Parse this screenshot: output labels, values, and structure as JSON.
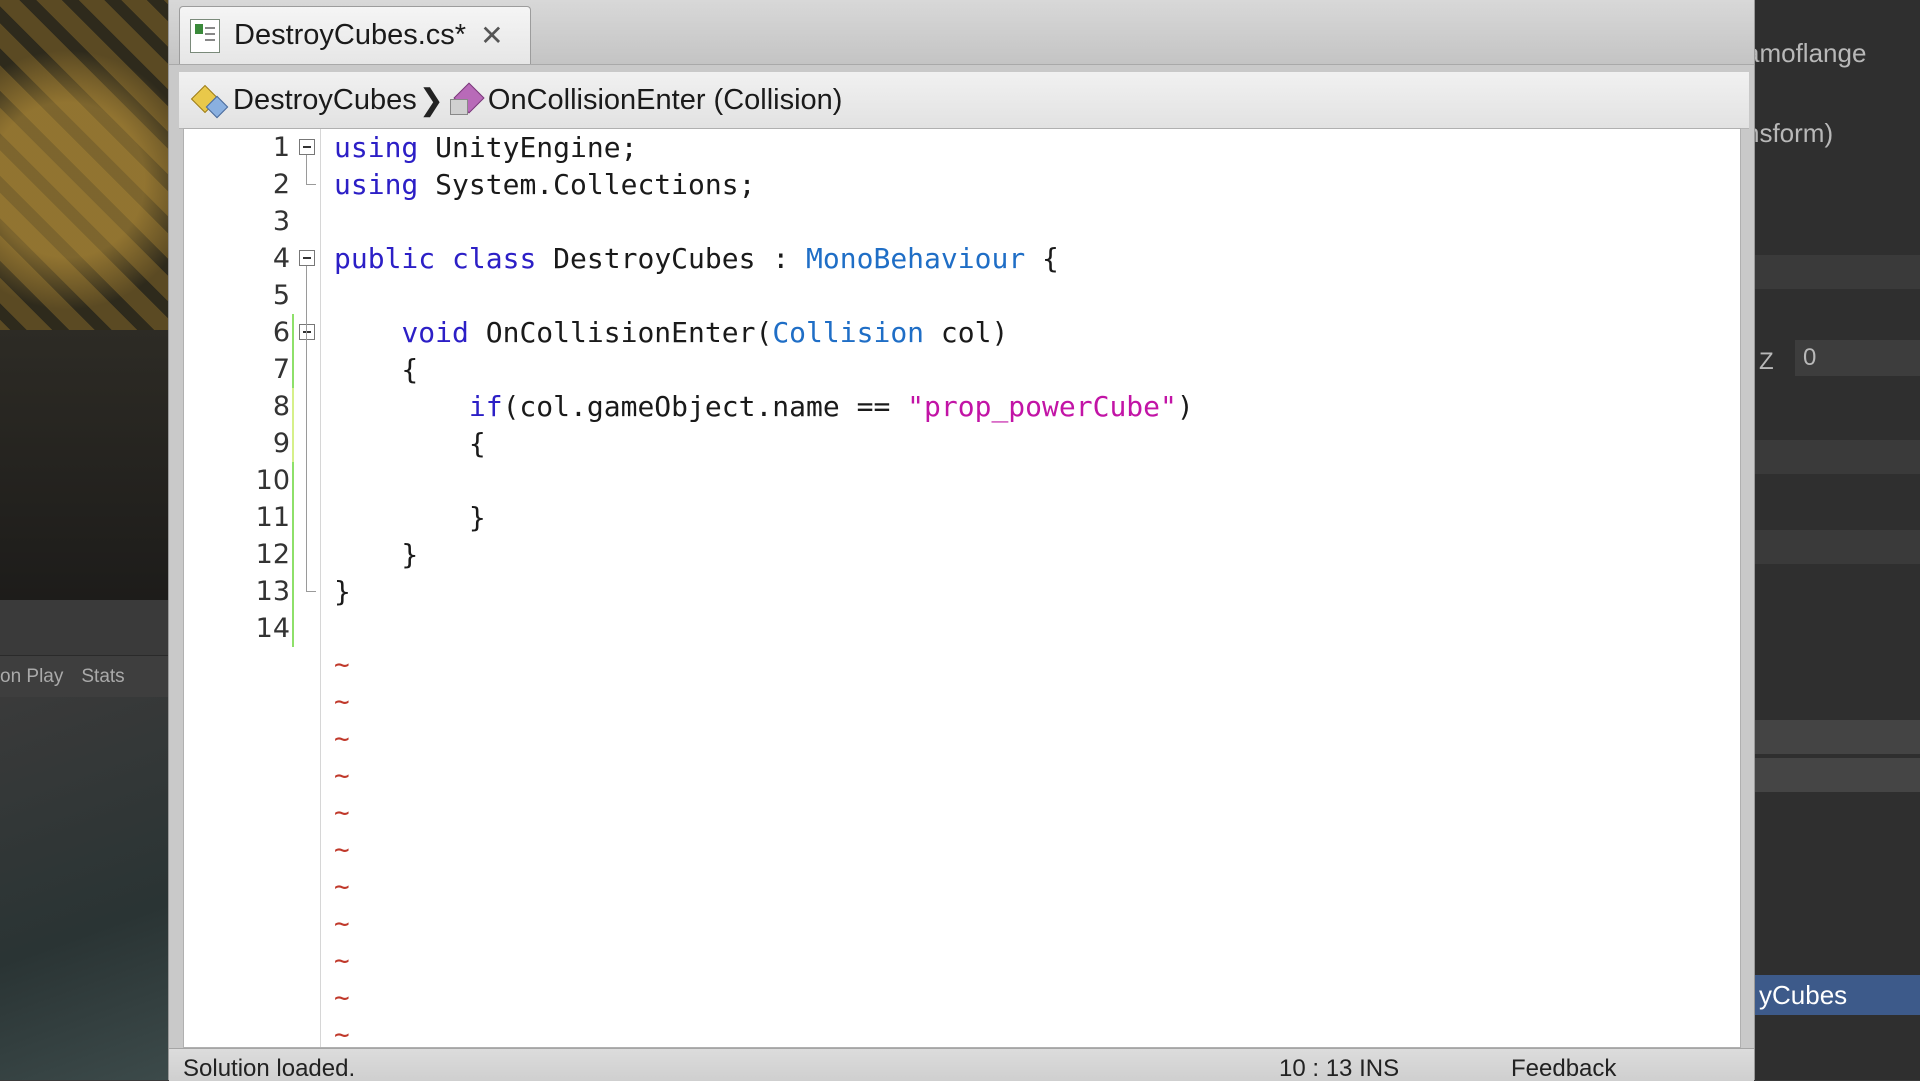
{
  "editor": {
    "tab_title": "DestroyCubes.cs*",
    "tab_close": "✕",
    "breadcrumb": {
      "class_name": "DestroyCubes",
      "separator": "❯",
      "method_name": "OnCollisionEnter (Collision)"
    },
    "line_numbers": [
      "1",
      "2",
      "3",
      "4",
      "5",
      "6",
      "7",
      "8",
      "9",
      "10",
      "11",
      "12",
      "13",
      "14"
    ],
    "code": [
      [
        "using",
        " UnityEngine;"
      ],
      [
        "using",
        " System.Collections;"
      ],
      [],
      [
        "public",
        " ",
        "class",
        " DestroyCubes : ",
        "MonoBehaviour",
        " {"
      ],
      [],
      [
        "    ",
        "void",
        " OnCollisionEnter(",
        "Collision",
        " col)"
      ],
      [
        "    {"
      ],
      [
        "        ",
        "if",
        "(col.gameObject.name == ",
        "\"prop_powerCube\"",
        ")"
      ],
      [
        "        {"
      ],
      [],
      [
        "        }"
      ],
      [
        "    }"
      ],
      [
        "}"
      ],
      []
    ],
    "empty_line_marker": "~",
    "status": {
      "left": "Solution loaded.",
      "position": "10 : 13   INS",
      "feedback": "Feedback"
    }
  },
  "scene": {
    "tabs": [
      "on Play",
      "Stats"
    ]
  },
  "inspector": {
    "texts": [
      "amoflange",
      "nsform)",
      "Z",
      "0"
    ],
    "selected_item": "yCubes"
  },
  "colors": {
    "keyword": "#2c1fc6",
    "type": "#1f6ec6",
    "string": "#c214a6",
    "tilde": "#c0392b",
    "change_saved": "#8ee06a",
    "change_unsaved": "#d6f08a"
  }
}
